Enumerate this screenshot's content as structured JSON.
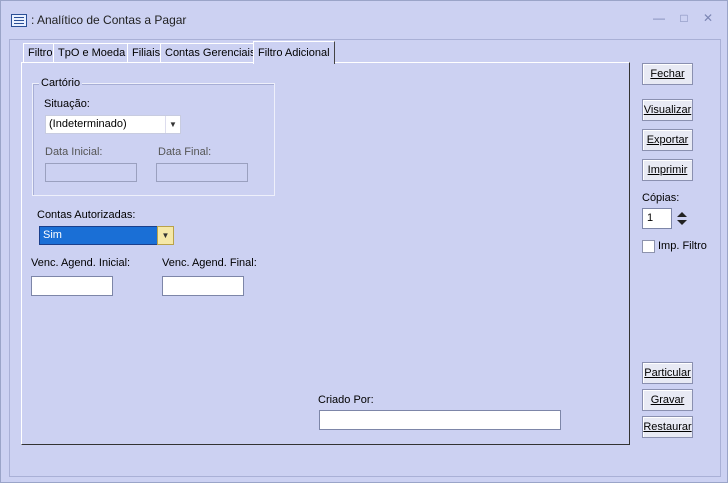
{
  "window": {
    "title": ": Analítico de Contas a Pagar",
    "controls": [
      "minimize-icon",
      "restore-icon",
      "close-icon"
    ]
  },
  "tabs": [
    {
      "label": "Filtro",
      "active": false
    },
    {
      "label": "TpO e Moeda",
      "active": false
    },
    {
      "label": "Filiais",
      "active": false
    },
    {
      "label": "Contas Gerenciais",
      "active": false
    },
    {
      "label": "Filtro Adicional",
      "active": true
    }
  ],
  "cartorio": {
    "group_title": "Cartório",
    "situacao_label": "Situação:",
    "situacao_value": "(Indeterminado)",
    "data_inicial_label": "Data Inicial:",
    "data_inicial_value": "",
    "data_final_label": "Data Final:",
    "data_final_value": ""
  },
  "contas_autorizadas": {
    "label": "Contas Autorizadas:",
    "value": "Sim"
  },
  "venc": {
    "inicial_label": "Venc. Agend. Inicial:",
    "inicial_value": "",
    "final_label": "Venc. Agend. Final:",
    "final_value": ""
  },
  "criado_por": {
    "label": "Criado Por:",
    "value": ""
  },
  "side": {
    "fechar": "Fechar",
    "visualizar": "Visualizar",
    "exportar": "Exportar",
    "imprimir": "Imprimir",
    "copias_label": "Cópias:",
    "copias_value": "1",
    "imp_filtro": "Imp. Filtro",
    "particular": "Particular",
    "gravar": "Gravar",
    "restaurar": "Restaurar"
  },
  "colors": {
    "background": "#ccd1f2",
    "selection": "#1a6fd6",
    "dropdown_button": "#f5e8a8"
  }
}
